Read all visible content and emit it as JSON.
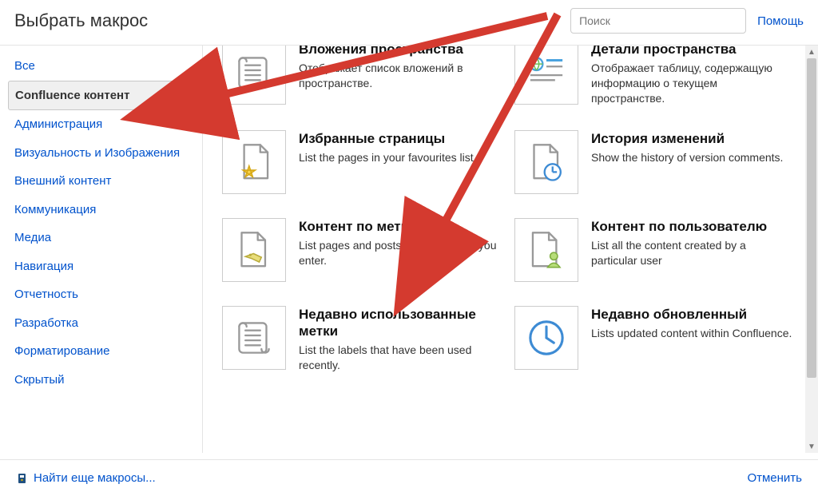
{
  "header": {
    "title": "Выбрать макрос",
    "search_placeholder": "Поиск",
    "help_label": "Помощь"
  },
  "sidebar": {
    "items": [
      {
        "label": "Все",
        "selected": false
      },
      {
        "label": "Confluence контент",
        "selected": true
      },
      {
        "label": "Администрация",
        "selected": false
      },
      {
        "label": "Визуальность и Изображения",
        "selected": false
      },
      {
        "label": "Внешний контент",
        "selected": false
      },
      {
        "label": "Коммуникация",
        "selected": false
      },
      {
        "label": "Медиа",
        "selected": false
      },
      {
        "label": "Навигация",
        "selected": false
      },
      {
        "label": "Отчетность",
        "selected": false
      },
      {
        "label": "Разработка",
        "selected": false
      },
      {
        "label": "Форматирование",
        "selected": false
      },
      {
        "label": "Скрытый",
        "selected": false
      }
    ]
  },
  "macros": [
    {
      "icon": "scroll",
      "title": "Вложения пространства",
      "desc": "Отображает список вложений в пространстве."
    },
    {
      "icon": "space-details",
      "title": "Детали пространства",
      "desc": "Отображает таблицу, содержащую информацию о текущем пространстве."
    },
    {
      "icon": "page-star",
      "title": "Избранные страницы",
      "desc": "List the pages in your favourites list."
    },
    {
      "icon": "page-clock",
      "title": "История изменений",
      "desc": "Show the history of version comments."
    },
    {
      "icon": "page-tag",
      "title": "Контент по метке",
      "desc": "List pages and posts with the labels you enter."
    },
    {
      "icon": "page-user",
      "title": "Контент по пользователю",
      "desc": "List all the content created by a particular user"
    },
    {
      "icon": "scroll",
      "title": "Недавно использованные метки",
      "desc": "List the labels that have been used recently."
    },
    {
      "icon": "clock",
      "title": "Недавно обновленный",
      "desc": "Lists updated content within Confluence."
    }
  ],
  "footer": {
    "find_more": "Найти еще макросы...",
    "cancel": "Отменить"
  }
}
